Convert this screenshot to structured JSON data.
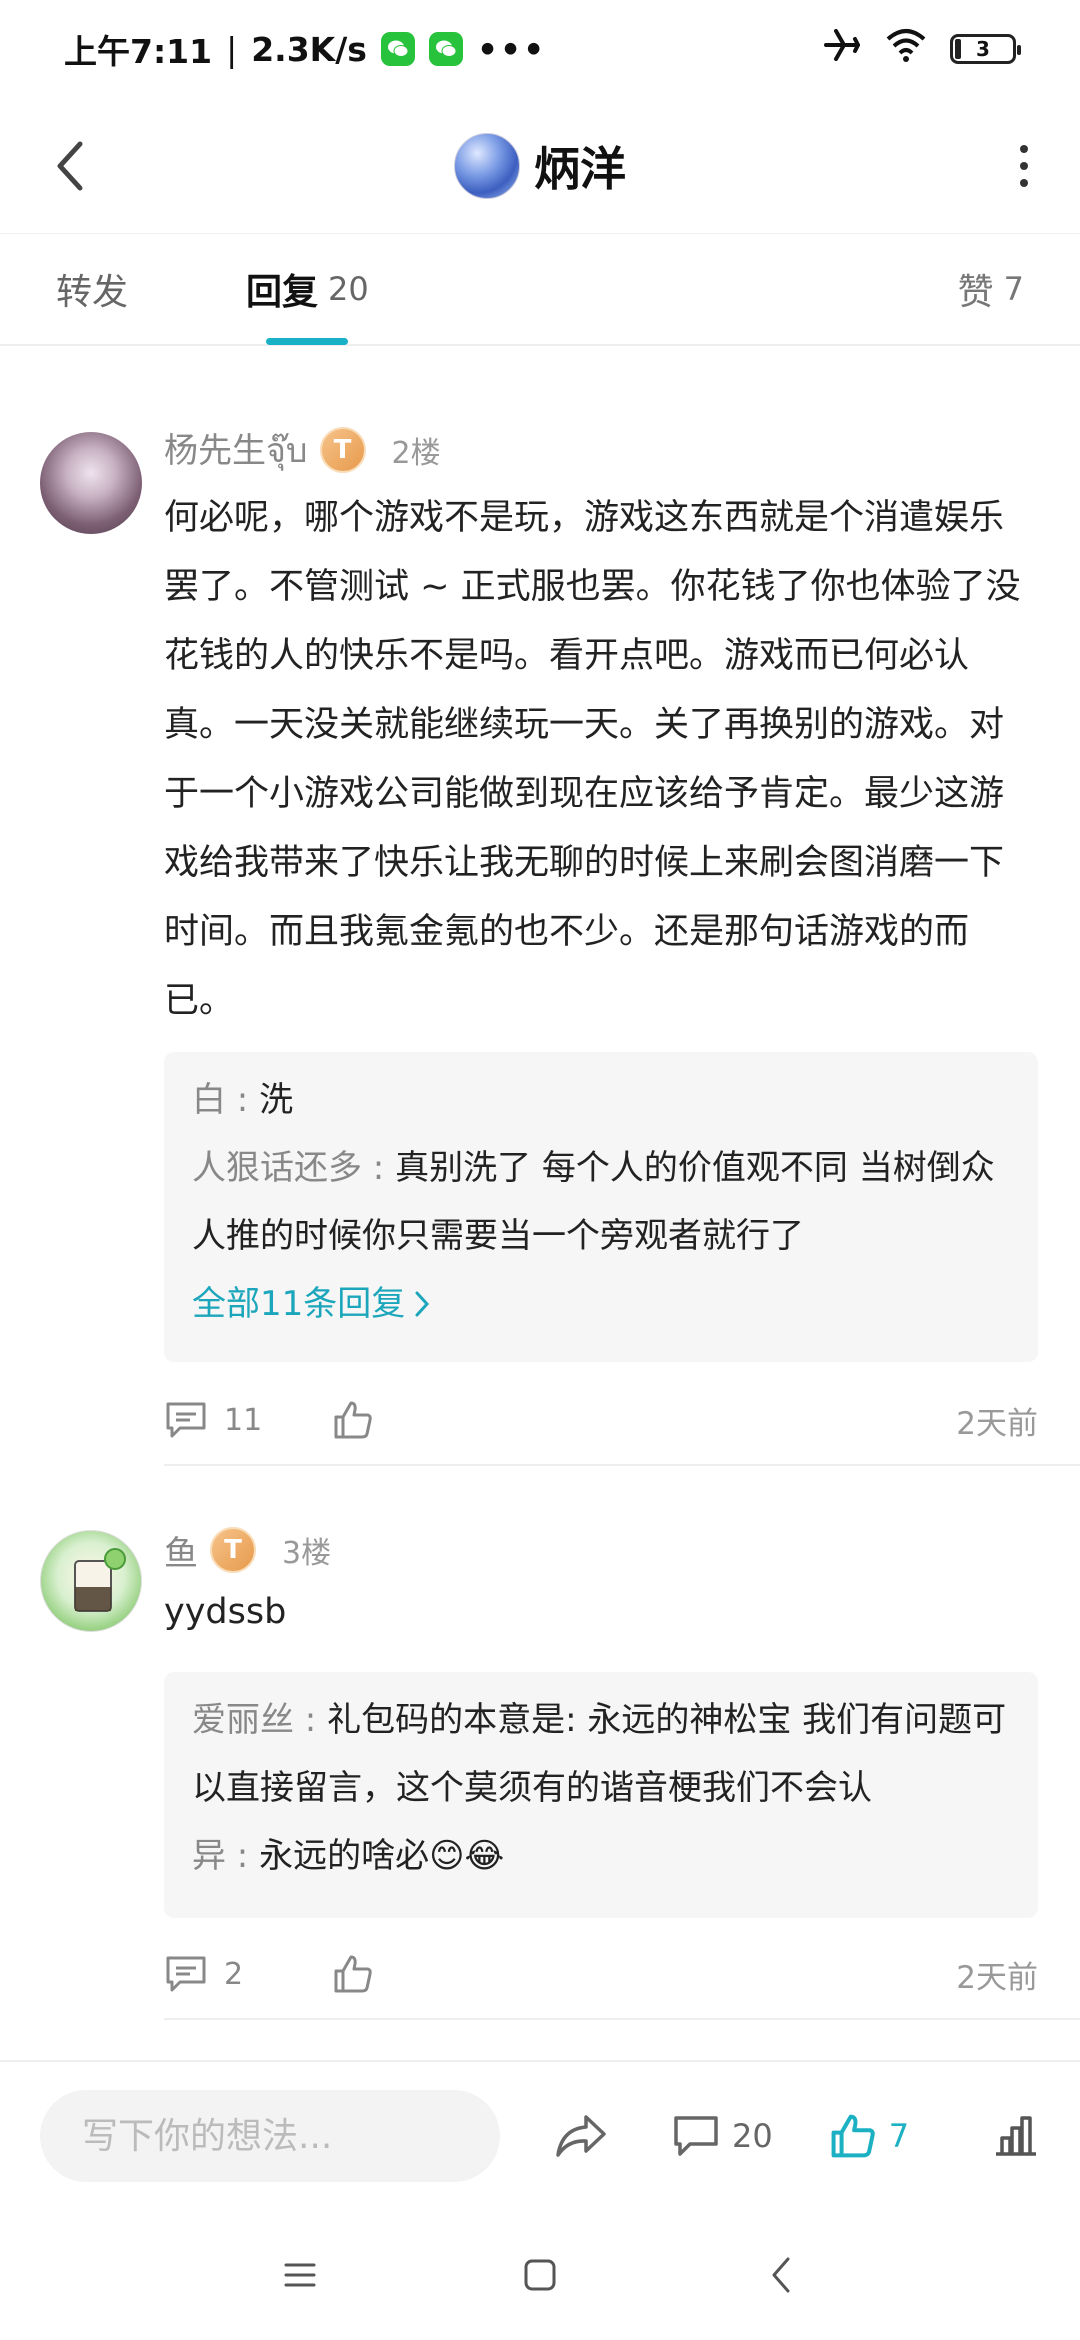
{
  "status_bar": {
    "time": "上午7:11",
    "speed": "2.3K/s",
    "battery": "3",
    "icons": [
      "wechat-icon",
      "wechat-icon",
      "more-dots",
      "airplane-icon",
      "wifi-icon",
      "battery-icon"
    ]
  },
  "header": {
    "name": "炳洋"
  },
  "tabs": {
    "forward": "转发",
    "reply": "回复",
    "reply_count": "20",
    "like": "赞",
    "like_count": "7"
  },
  "comments": [
    {
      "username": "杨先生จุ๊บ",
      "level": "T",
      "floor": "2楼",
      "text": "何必呢，哪个游戏不是玩，游戏这东西就是个消遣娱乐罢了。不管测试 ~ 正式服也罢。你花钱了你也体验了没花钱的人的快乐不是吗。看开点吧。游戏而已何必认真。一天没关就能继续玩一天。关了再换别的游戏。对于一个小游戏公司能做到现在应该给予肯定。最少这游戏给我带来了快乐让我无聊的时候上来刷会图消磨一下时间。而且我氪金氪的也不少。还是那句话游戏的而已。",
      "replies": [
        {
          "name": "白",
          "sep": " : ",
          "text": "洗"
        },
        {
          "name": "人狠话还多",
          "sep": " : ",
          "text": "真别洗了 每个人的价值观不同 当树倒众人推的时候你只需要当一个旁观者就行了"
        }
      ],
      "view_all": "全部11条回复",
      "reply_count": "11",
      "time": "2天前"
    },
    {
      "username": "鱼",
      "level": "T",
      "floor": "3楼",
      "text": "yydssb",
      "replies": [
        {
          "name": "爱丽丝",
          "sep": " : ",
          "text": "礼包码的本意是: 永远的神松宝 我们有问题可以直接留言，这个莫须有的谐音梗我们不会认"
        },
        {
          "name": "异",
          "sep": " : ",
          "text": "永远的啥必😊😂"
        }
      ],
      "reply_count": "2",
      "time": "2天前"
    }
  ],
  "action_bar": {
    "input_placeholder": "写下你的想法...",
    "comment_count": "20",
    "like_count": "7",
    "accent_color": "#1cb0c3"
  }
}
